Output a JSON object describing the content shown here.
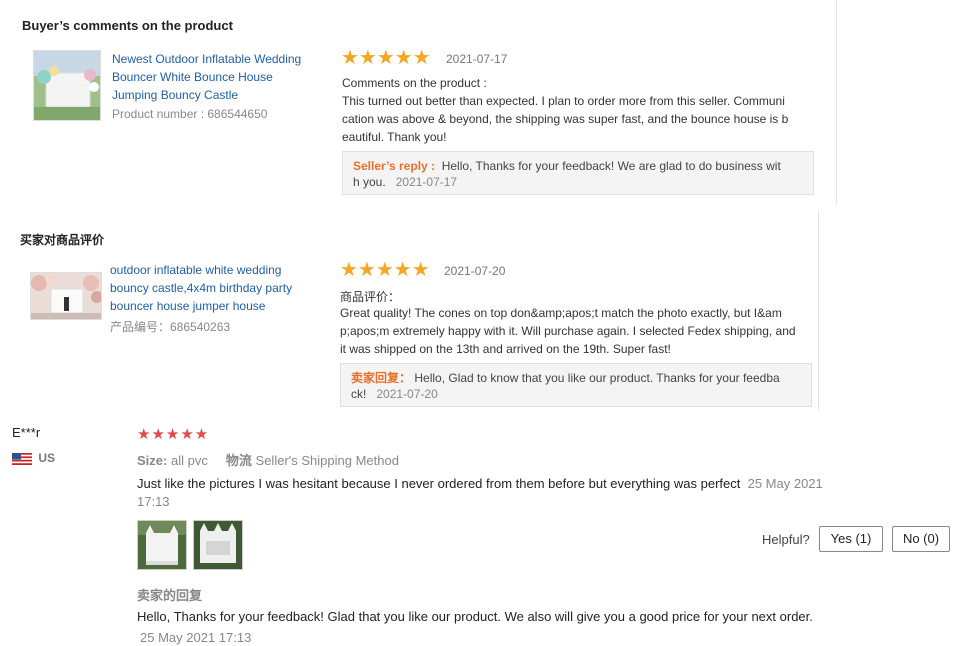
{
  "review1": {
    "section_title": "Buyer’s comments on the product",
    "product_title_lines": [
      "Newest Outdoor Inflatable Wedding",
      "Bouncer White Bounce House",
      "Jumping Bouncy Castle"
    ],
    "product_number": "Product number : 686544650",
    "stars": "★★★★★",
    "date": "2021-07-17",
    "comment_label": "Comments on the product :",
    "comment_lines": [
      "This turned out better than expected. I plan to order more from this seller. Communi",
      "cation was above & beyond, the shipping was super fast, and the bounce house is b",
      "eautiful. Thank you!"
    ],
    "reply_label": "Seller’s reply :",
    "reply_line1": "Hello, Thanks for your feedback! We are glad to do business wit",
    "reply_line2": "h you.",
    "reply_date": "2021-07-17"
  },
  "review2": {
    "section_title": "买家对商品评价",
    "product_title_lines": [
      "outdoor inflatable white wedding",
      "bouncy castle,4x4m birthday party",
      "bouncer house jumper house"
    ],
    "product_number": "产品编号：686540263",
    "stars": "★★★★★",
    "date": "2021-07-20",
    "comment_label": "商品评价：",
    "comment_lines": [
      "Great quality! The cones on top don&amp;apos;t match the photo exactly, but I&am",
      "p;apos;m extremely happy with it. Will purchase again. I selected Fedex shipping, and",
      "it was shipped on the 13th and arrived on the 19th. Super fast!"
    ],
    "reply_label": "卖家回复：",
    "reply_line1": "Hello, Glad to know that you like our product. Thanks for your feedba",
    "reply_line2": "ck!",
    "reply_date": "2021-07-20"
  },
  "review3": {
    "user": "E***r",
    "country": "US",
    "stars": "★★★★★",
    "size_label": "Size:",
    "size_value": "all pvc",
    "logistics_label": "物流",
    "logistics_value": "Seller's Shipping Method",
    "comment": "Just like the pictures I was hesitant because I never ordered from them before but everything was perfect",
    "date_part1": "25 May 2021",
    "date_part2": "17:13",
    "helpful_label": "Helpful?",
    "yes_label": "Yes (1)",
    "no_label": "No (0)",
    "reply_heading": "卖家的回复",
    "reply_text": "Hello, Thanks for your feedback! Glad that you like our product. We also will give you a good price for your next order.",
    "reply_date": "25 May 2021 17:13"
  },
  "colors": {
    "link": "#1f5fa8",
    "star_gold": "#f5a623",
    "star_red": "#e24b4b",
    "reply_orange": "#e8702a"
  }
}
